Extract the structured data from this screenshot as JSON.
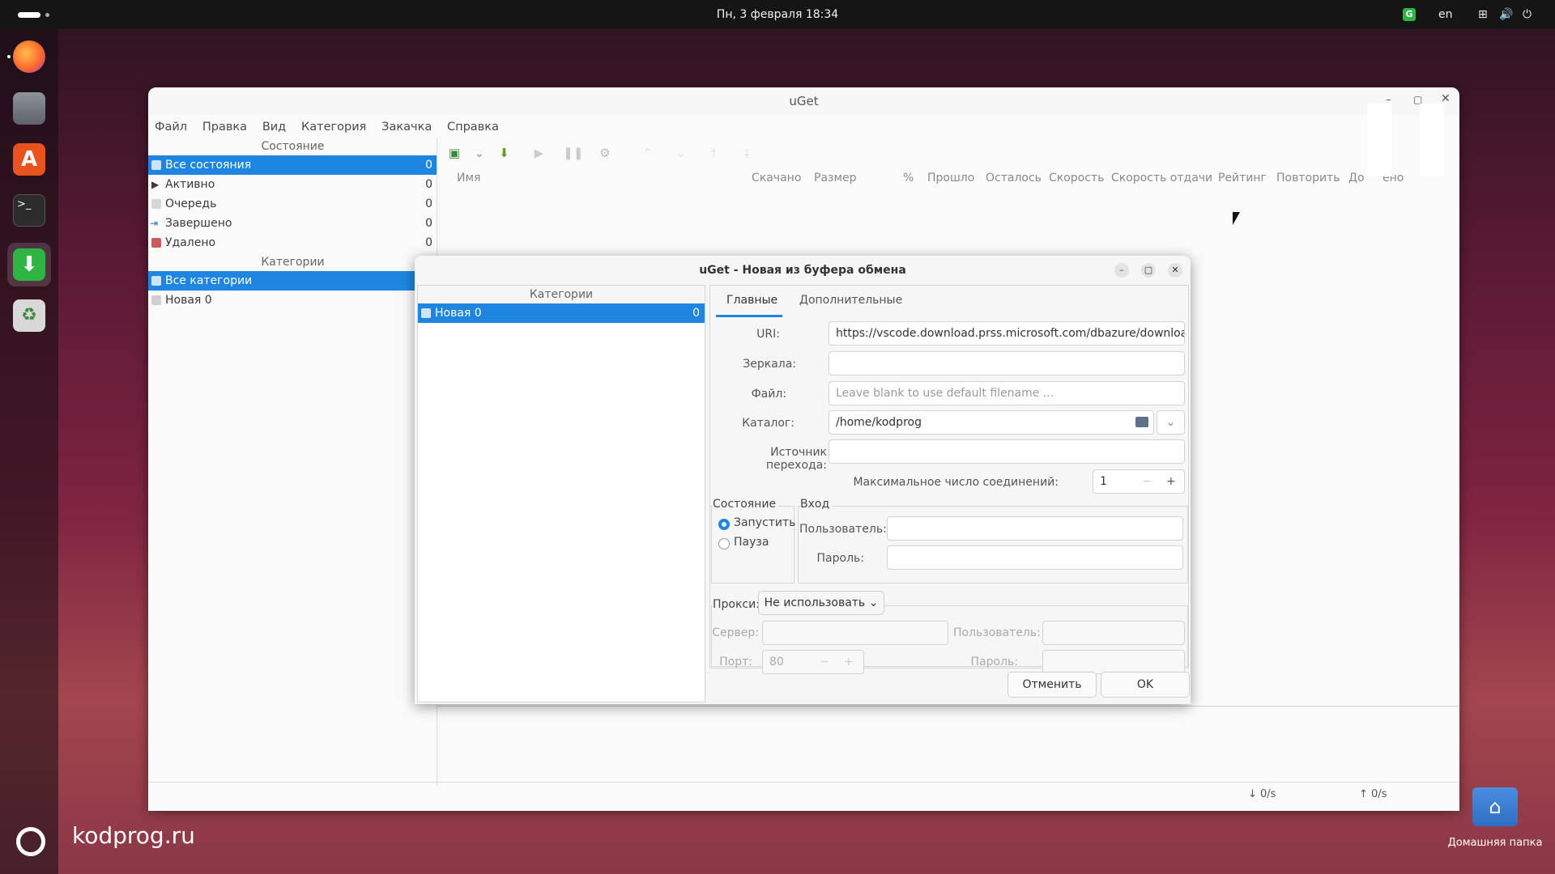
{
  "topbar": {
    "clock": "Пн, 3 февраля  18:34",
    "lang": "en"
  },
  "dock": {
    "items": [
      "firefox-icon",
      "files-icon",
      "app-center-icon",
      "terminal-icon",
      "uget-icon",
      "trash-icon"
    ]
  },
  "desktop": {
    "brand": "kodprog.ru",
    "home_folder": "Домашняя папка"
  },
  "window": {
    "title": "uGet",
    "menu": [
      "Файл",
      "Правка",
      "Вид",
      "Категория",
      "Закачка",
      "Справка"
    ],
    "state_header": "Состояние",
    "states": [
      {
        "label": "Все состояния",
        "count": "0"
      },
      {
        "label": "Активно",
        "count": "0"
      },
      {
        "label": "Очередь",
        "count": "0"
      },
      {
        "label": "Завершено",
        "count": "0"
      },
      {
        "label": "Удалено",
        "count": "0"
      }
    ],
    "categories_header": "Категории",
    "categories": [
      "Все категории",
      "Новая 0"
    ],
    "columns": [
      "Имя",
      "Скачано",
      "Размер",
      "%",
      "Прошло",
      "Осталось",
      "Скорость",
      "Скорость отдачи",
      "Рейтинг",
      "Повторить",
      "До",
      "ено"
    ],
    "status": {
      "down": "↓ 0/s",
      "up": "↑ 0/s"
    }
  },
  "dialog": {
    "title": "uGet - Новая из буфера обмена",
    "categories_header": "Категории",
    "category": {
      "label": "Новая 0",
      "count": "0"
    },
    "tabs": [
      "Главные",
      "Дополнительные"
    ],
    "labels": {
      "uri": "URI:",
      "mirrors": "Зеркала:",
      "file": "Файл:",
      "folder": "Каталог:",
      "referrer": "Источник перехода:",
      "max_conn": "Максимальное число соединений:",
      "state": "Состояние",
      "login": "Вход",
      "user": "Пользователь:",
      "password": "Пароль:",
      "proxy": "Прокси:",
      "server": "Сервер:",
      "port": "Порт:"
    },
    "values": {
      "uri": "https://vscode.download.prss.microsoft.com/dbazure/download/",
      "file_placeholder": "Leave blank to use default filename ...",
      "folder": "/home/kodprog",
      "max_conn": "1",
      "proxy": "Не использовать",
      "port": "80"
    },
    "state_options": [
      "Запустить",
      "Пауза"
    ],
    "buttons": {
      "cancel": "Отменить",
      "ok": "OK"
    }
  }
}
